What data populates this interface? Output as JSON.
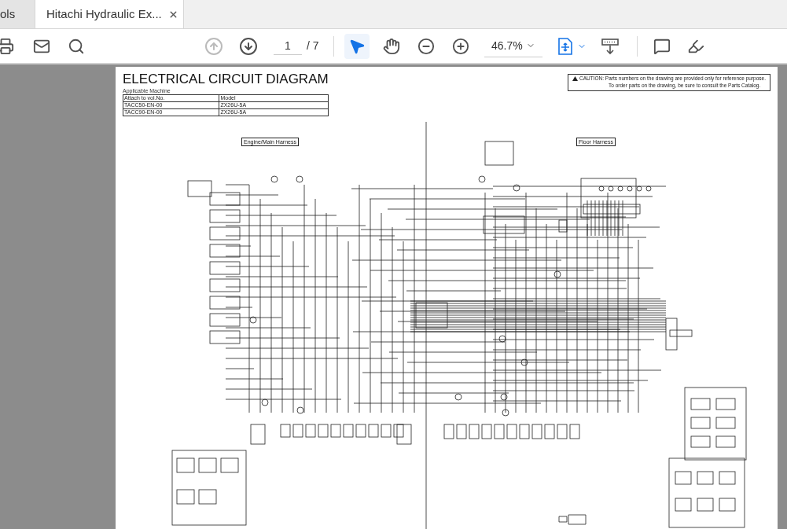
{
  "tabs": [
    {
      "label": "ols",
      "selected": false,
      "closable": false
    },
    {
      "label": "Hitachi Hydraulic Ex...",
      "selected": true,
      "closable": true
    }
  ],
  "toolbar": {
    "previous_page_disabled": true,
    "next_page_disabled": false,
    "page": "1",
    "page_total": "/ 7",
    "zoom": "46.7%",
    "tools": [
      {
        "kind": "select",
        "selected": true
      },
      {
        "kind": "hand",
        "selected": false
      }
    ]
  },
  "document": {
    "title": "ELECTRICAL CIRCUIT DIAGRAM",
    "applicable_label": "Applicable Machine",
    "table": {
      "columns": [
        "Attach to vol.No.",
        "Model"
      ],
      "rows": [
        [
          "TACC50-EN-00",
          "ZX26U-5A"
        ],
        [
          "TACC90-EN-00",
          "ZX26U-5A"
        ]
      ]
    },
    "caution": {
      "heading": "CAUTION:",
      "line_1": "Parts numbers on the drawing are provided only for reference purpose.",
      "line_2": "To order parts on the drawing, be sure to consult the Parts Catalog."
    },
    "sections": [
      {
        "label": "Engine/Main Harness"
      },
      {
        "label": "Floor Harness"
      }
    ]
  }
}
